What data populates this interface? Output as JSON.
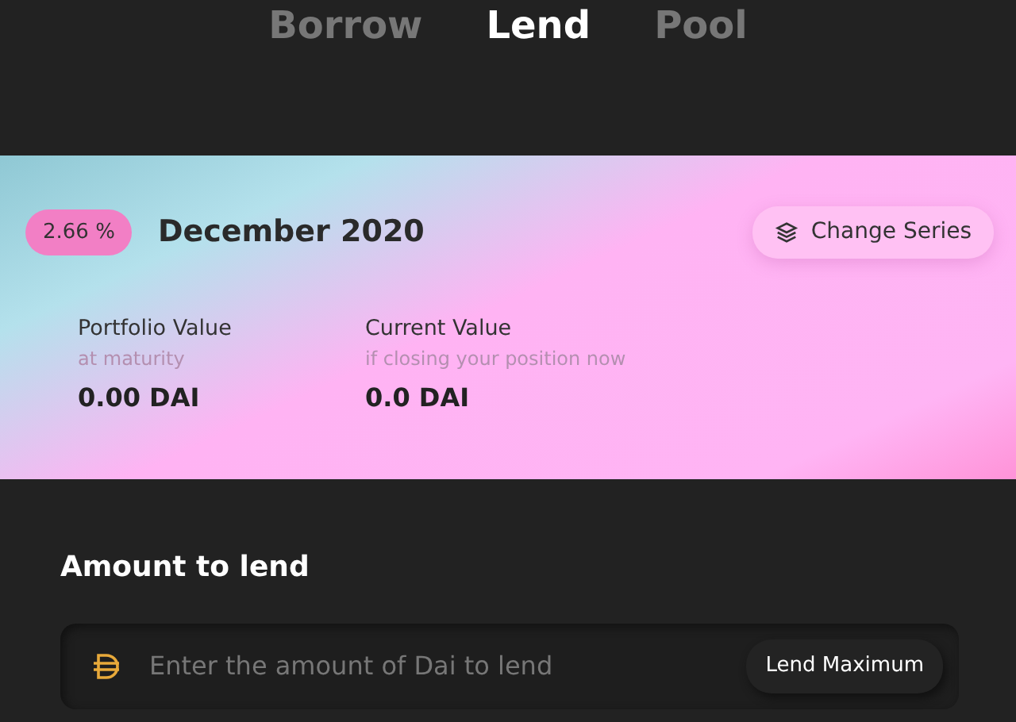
{
  "tabs": [
    {
      "label": "Borrow",
      "selected": false
    },
    {
      "label": "Lend",
      "selected": true
    },
    {
      "label": "Pool",
      "selected": false
    }
  ],
  "series": {
    "rate": "2.66 %",
    "title": "December 2020",
    "change_button": "Change Series"
  },
  "values": [
    {
      "label": "Portfolio Value",
      "sublabel": "at maturity",
      "amount": "0.00 DAI"
    },
    {
      "label": "Current Value",
      "sublabel": "if closing your position now",
      "amount": "0.0 DAI"
    }
  ],
  "amount_section": {
    "heading": "Amount to lend",
    "placeholder": "Enter the amount of Dai to lend",
    "max_button": "Lend Maximum"
  }
}
